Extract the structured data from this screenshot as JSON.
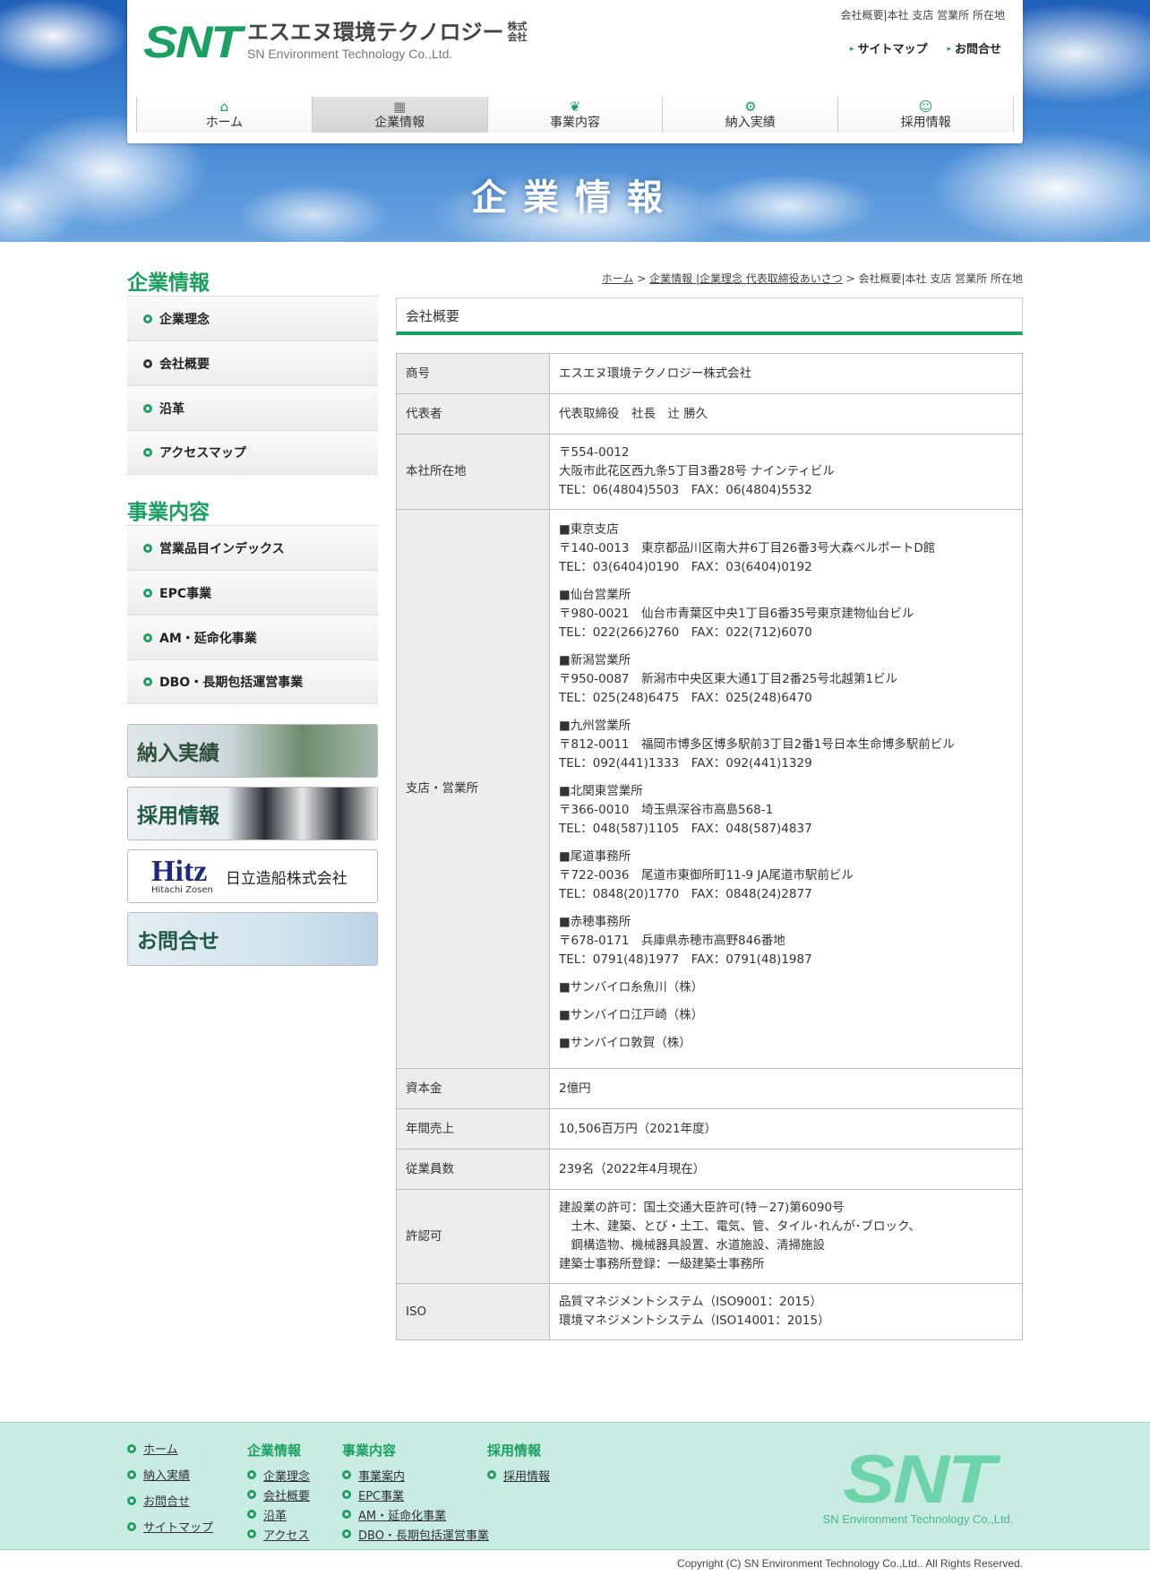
{
  "header": {
    "logo_mark": "SNT",
    "logo_jp": "エスエヌ環境テクノロジー",
    "logo_kabu": "株式会社",
    "logo_en": "SN Environment Technology Co.,Ltd.",
    "util_top": "会社概要|本社 支店 営業所 所在地",
    "sitemap": "サイトマップ",
    "contact": "お問合せ"
  },
  "gnav": [
    {
      "label": "ホーム",
      "icon": "home-icon",
      "glyph": "⌂"
    },
    {
      "label": "企業情報",
      "icon": "building-icon",
      "glyph": "▦"
    },
    {
      "label": "事業内容",
      "icon": "leaf-icon",
      "glyph": "❦"
    },
    {
      "label": "納入実績",
      "icon": "gear-icon",
      "glyph": "⚙"
    },
    {
      "label": "採用情報",
      "icon": "person-icon",
      "glyph": "☺"
    }
  ],
  "hero_title": "企業情報",
  "sidebar": {
    "heading1": "企業情報",
    "menu1": [
      "企業理念",
      "会社概要",
      "沿革",
      "アクセスマップ"
    ],
    "heading2": "事業内容",
    "menu2": [
      "営業品目インデックス",
      "EPC事業",
      "AM・延命化事業",
      "DBO・長期包括運営事業"
    ],
    "banners": {
      "delivery": "納入実績",
      "recruit": "採用情報",
      "hitz_logo": "Hitz",
      "hitz_sub": "Hitachi Zosen",
      "hitz_name": "日立造船株式会社",
      "contact": "お問合せ"
    }
  },
  "breadcrumb": {
    "home": "ホーム",
    "sep1": " > ",
    "mid": "企業情報 |企業理念 代表取締役あいさつ",
    "sep2": " > ",
    "current": "会社概要|本社 支店 営業所 所在地"
  },
  "section_title": "会社概要",
  "table": {
    "rows": {
      "name": {
        "k": "商号",
        "v": "エスエヌ環境テクノロジー株式会社"
      },
      "rep": {
        "k": "代表者",
        "v": "代表取締役　社長　辻 勝久"
      },
      "hq": {
        "k": "本社所在地",
        "l1": "〒554-0012",
        "l2": "大阪市此花区西九条5丁目3番28号 ナインティビル",
        "l3": "TEL：06(4804)5503　FAX：06(4804)5532"
      },
      "branch": {
        "k": "支店・営業所"
      },
      "capital": {
        "k": "資本金",
        "v": "2億円"
      },
      "sales": {
        "k": "年間売上",
        "v": "10,506百万円（2021年度）"
      },
      "employees": {
        "k": "従業員数",
        "v": "239名（2022年4月現在）"
      },
      "license": {
        "k": "許認可",
        "l1": "建設業の許可：国土交通大臣許可(特－27)第6090号",
        "l2": "　土木、建築、とび・土工、電気、管、タイル･れんが･ブロック、",
        "l3": "　鋼構造物、機械器具設置、水道施設、清掃施設",
        "l4": "建築士事務所登録：一級建築士事務所"
      },
      "iso": {
        "k": "ISO",
        "l1": "品質マネジメントシステム（ISO9001：2015）",
        "l2": "環境マネジメントシステム（ISO14001：2015）"
      }
    },
    "branches": [
      {
        "name": "■東京支店",
        "addr": "〒140-0013　東京都品川区南大井6丁目26番3号大森ベルポートD館",
        "tel": "TEL：03(6404)0190　FAX：03(6404)0192"
      },
      {
        "name": "■仙台営業所",
        "addr": "〒980-0021　仙台市青葉区中央1丁目6番35号東京建物仙台ビル",
        "tel": "TEL：022(266)2760　FAX：022(712)6070"
      },
      {
        "name": "■新潟営業所",
        "addr": "〒950-0087　新潟市中央区東大通1丁目2番25号北越第1ビル",
        "tel": "TEL：025(248)6475　FAX：025(248)6470"
      },
      {
        "name": "■九州営業所",
        "addr": "〒812-0011　福岡市博多区博多駅前3丁目2番1号日本生命博多駅前ビル",
        "tel": "TEL：092(441)1333　FAX：092(441)1329"
      },
      {
        "name": "■北関東営業所",
        "addr": "〒366-0010　埼玉県深谷市高島568-1",
        "tel": "TEL：048(587)1105　FAX：048(587)4837"
      },
      {
        "name": "■尾道事務所",
        "addr": "〒722-0036　尾道市東御所町11-9 JA尾道市駅前ビル",
        "tel": "TEL：0848(20)1770　FAX：0848(24)2877"
      },
      {
        "name": "■赤穂事務所",
        "addr": "〒678-0171　兵庫県赤穂市高野846番地",
        "tel": "TEL：0791(48)1977　FAX：0791(48)1987"
      }
    ],
    "affiliates": [
      "■サンバイロ糸魚川（株）",
      "■サンバイロ江戸崎（株）",
      "■サンバイロ敦賀（株）"
    ]
  },
  "footer": {
    "col1": [
      "ホーム",
      "納入実績",
      "お問合せ",
      "サイトマップ"
    ],
    "col2_head": "企業情報",
    "col2": [
      "企業理念",
      "会社概要",
      "沿革",
      "アクセス"
    ],
    "col3_head": "事業内容",
    "col3": [
      "事業案内",
      "EPC事業",
      "AM・延命化事業",
      "DBO・長期包括運営事業"
    ],
    "col4_head": "採用情報",
    "col4": [
      "採用情報"
    ],
    "logo_mark": "SNT",
    "logo_en": "SN Environment Technology Co.,Ltd.",
    "copyright": "Copyright (C) SN Environment Technology Co.,Ltd.. All Rights Reserved."
  },
  "colors": {
    "brand_green": "#1aa061",
    "footer_bg": "#c8ece1"
  }
}
